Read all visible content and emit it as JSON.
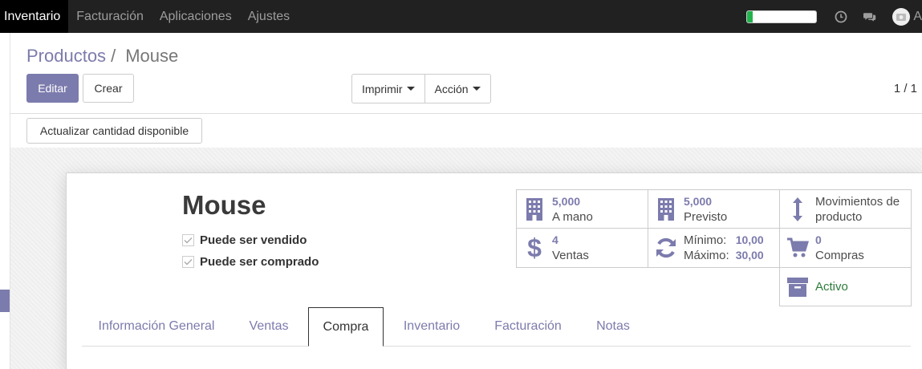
{
  "topnav": {
    "apps": [
      {
        "label": "Inventario",
        "active": true
      },
      {
        "label": "Facturación"
      },
      {
        "label": "Aplicaciones"
      },
      {
        "label": "Ajustes"
      }
    ],
    "progress_fraction": 0.08,
    "user_initial": "A"
  },
  "breadcrumb": {
    "parent": "Productos",
    "separator": "/",
    "current": "Mouse"
  },
  "buttons": {
    "edit": "Editar",
    "create": "Crear",
    "print": "Imprimir",
    "action": "Acción",
    "update_qty": "Actualizar cantidad disponible"
  },
  "pager": "1 / 1",
  "product": {
    "name": "Mouse",
    "can_be_sold": "Puede ser vendido",
    "can_be_purchased": "Puede ser comprado"
  },
  "stats": {
    "on_hand": {
      "value": "5,000",
      "label": "A mano"
    },
    "forecast": {
      "value": "5,000",
      "label": "Previsto"
    },
    "moves": {
      "line1": "Movimientos de",
      "line2": "producto"
    },
    "sales": {
      "value": "4",
      "label": "Ventas"
    },
    "minmax": {
      "min_label": "Mínimo:",
      "min_value": "10,00",
      "max_label": "Máximo:",
      "max_value": "30,00"
    },
    "purchases": {
      "value": "0",
      "label": "Compras"
    },
    "active": {
      "label": "Activo"
    }
  },
  "tabs": [
    {
      "label": "Información General"
    },
    {
      "label": "Ventas"
    },
    {
      "label": "Compra",
      "active": true
    },
    {
      "label": "Inventario"
    },
    {
      "label": "Facturación"
    },
    {
      "label": "Notas"
    }
  ],
  "colors": {
    "accent": "#7c7bad",
    "active_green": "#2d7b3a",
    "progress_green": "#21b24b"
  }
}
